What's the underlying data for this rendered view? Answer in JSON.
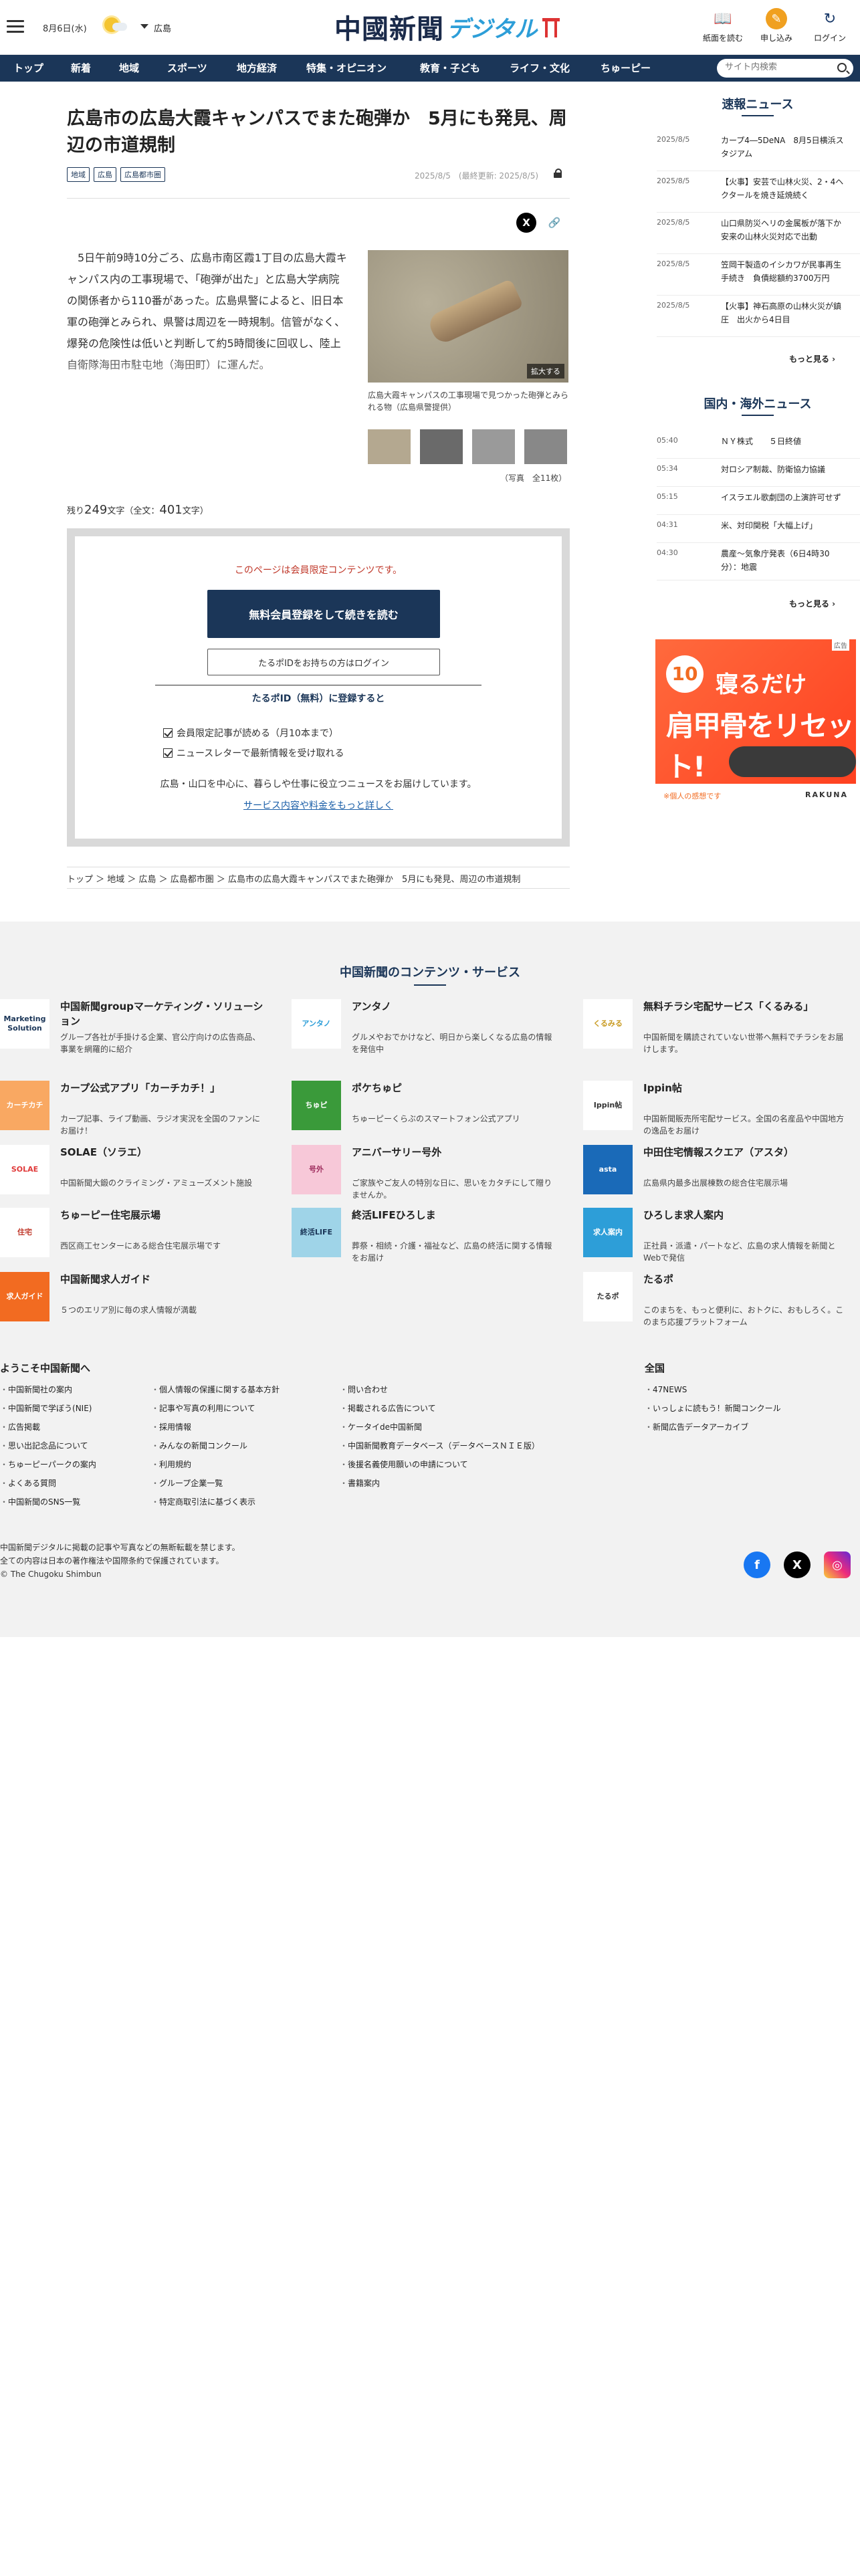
{
  "header": {
    "date": "8月6日(水)",
    "region": "広島",
    "logo_kanji": "中國新聞",
    "logo_digital": "デジタル",
    "buttons": {
      "paper": "紙面を読む",
      "apply": "申し込み",
      "login": "ログイン"
    }
  },
  "nav": {
    "items": [
      "トップ",
      "新着",
      "地域",
      "スポーツ",
      "地方経済",
      "特集・オピニオン",
      "教育・子ども",
      "ライフ・文化",
      "ちゅーピー"
    ],
    "search_placeholder": "サイト内検索"
  },
  "article": {
    "title": "広島市の広島大霞キャンパスでまた砲弾か　5月にも発見、周辺の市道規制",
    "tags": [
      "地域",
      "広島",
      "広島都市圏"
    ],
    "date": "2025/8/5　(最終更新: 2025/8/5)",
    "body": "　5日午前9時10分ごろ、広島市南区霞1丁目の広島大霞キャンパス内の工事現場で、「砲弾が出た」と広島大学病院の関係者から110番があった。広島県警によると、旧日本軍の砲弾とみられ、県警は周辺を一時規制。信管がなく、爆発の危険性は低いと判断して約5時間後に回収し、陸上自衛隊海田市駐屯地（海田町）に運んだ。",
    "photo_zoom": "拡大する",
    "photo_caption": "広島大霞キャンパスの工事現場で見つかった砲弾とみられる物（広島県警提供）",
    "photo_count": "（写真　全11枚）",
    "remain_prefix": "残り",
    "remain_count": "249",
    "remain_mid": "文字（全文：",
    "total_count": "401",
    "remain_suffix": "文字）"
  },
  "paywall": {
    "notice": "このページは会員限定コンテンツです。",
    "register_button": "無料会員登録をして続きを読む",
    "login_button": "たるポIDをお持ちの方はログイン",
    "id_title": "たるポID（無料）に登録すると",
    "benefits": [
      "会員限定記事が読める（月10本まで）",
      "ニュースレターで最新情報を受け取れる"
    ],
    "desc": "広島・山口を中心に、暮らしや仕事に役立つニュースをお届けしています。",
    "more_link": "サービス内容や料金をもっと詳しく"
  },
  "breadcrumb": "トップ ＞ 地域 ＞ 広島 ＞ 広島都市圏 ＞ 広島市の広島大霞キャンパスでまた砲弾か　5月にも発見、周辺の市道規制",
  "sidebar": {
    "breaking_title": "速報ニュース",
    "breaking": [
      {
        "date": "2025/8/5",
        "title": "カープ4―5DeNA　8月5日横浜スタジアム"
      },
      {
        "date": "2025/8/5",
        "title": "【火事】安芸で山林火災、2・4ヘクタールを焼き延焼続く"
      },
      {
        "date": "2025/8/5",
        "title": "山口県防災ヘリの金属板が落下か　安来の山林火災対応で出動"
      },
      {
        "date": "2025/8/5",
        "title": "笠岡干製造のイシカワが民事再生手続き　負債総額約3700万円"
      },
      {
        "date": "2025/8/5",
        "title": "【火事】神石高原の山林火災が鎮圧　出火から4日目"
      }
    ],
    "more1": "もっと見る ›",
    "world_title": "国内・海外ニュース",
    "world": [
      {
        "date": "05:40",
        "title": "ＮＹ株式　　５日終値"
      },
      {
        "date": "05:34",
        "title": "対ロシア制裁、防衛協力協議"
      },
      {
        "date": "05:15",
        "title": "イスラエル歌劇団の上演許可せず"
      },
      {
        "date": "04:31",
        "title": "米、対印関税「大幅上げ」"
      },
      {
        "date": "04:30",
        "title": "農産〜気象庁発表（6日4時30分）：地震"
      }
    ],
    "more2": "もっと見る ›",
    "ad_label": "広告",
    "ad": {
      "badge": "10",
      "line1": "寝るだけ",
      "line2": "肩甲骨をリセット!",
      "foot_left": "※個人の感想です",
      "brand": "RAKUNA"
    }
  },
  "contents": {
    "title": "中国新聞のコンテンツ・サービス",
    "services": [
      {
        "name": "中国新聞groupマーケティング・ソリューション",
        "desc": "グループ各社が手掛ける企業、官公庁向けの広告商品、事業を網羅的に紹介",
        "icon": "Marketing Solution",
        "color": "#ffffff",
        "fg": "#1b3658"
      },
      {
        "name": "アンタノ",
        "desc": "グルメやおでかけなど、明日から楽しくなる広島の情報を発信中",
        "icon": "アンタノ",
        "color": "#ffffff",
        "fg": "#2d9ed8"
      },
      {
        "name": "無料チラシ宅配サービス「くるみる」",
        "desc": "中国新聞を購読されていない世帯へ無料でチラシをお届けします。",
        "icon": "くるみる",
        "color": "#ffffff",
        "fg": "#c89a20"
      },
      {
        "name": "カープ公式アプリ「カーチカチ！」",
        "desc": "カープ記事、ライブ動画、ラジオ実況を全国のファンにお届け！",
        "icon": "カーチカチ",
        "color": "#f9a862",
        "fg": "#ffffff"
      },
      {
        "name": "ポケちゅピ",
        "desc": "ちゅーピーくらぶのスマートフォン公式アプリ",
        "icon": "ちゅピ",
        "color": "#3a9a3a",
        "fg": "#ffffff"
      },
      {
        "name": "Ippin帖",
        "desc": "中国新聞販売所宅配サービス。全国の名産品や中国地方の逸品をお届け",
        "icon": "Ippin帖",
        "color": "#ffffff",
        "fg": "#333333"
      },
      {
        "name": "SOLAE（ソラエ）",
        "desc": "中国新聞大鍛のクライミング・アミューズメント施設",
        "icon": "SOLAE",
        "color": "#ffffff",
        "fg": "#e03a3a"
      },
      {
        "name": "アニバーサリー号外",
        "desc": "ご家族やご友人の特別な日に、思いをカタチにして贈りませんか。",
        "icon": "号外",
        "color": "#f7c8d8",
        "fg": "#a03060"
      },
      {
        "name": "中田住宅情報スクエア（アスタ）",
        "desc": "広島県内最多出展棟数の総合住宅展示場",
        "icon": "asta",
        "color": "#1a6ab8",
        "fg": "#ffffff"
      },
      {
        "name": "ちゅーピー住宅展示場",
        "desc": "西区商工センターにある総合住宅展示場です",
        "icon": "住宅",
        "color": "#ffffff",
        "fg": "#c0392b"
      },
      {
        "name": "終活LIFEひろしま",
        "desc": "葬祭・相続・介護・福祉など、広島の終活に関する情報をお届け",
        "icon": "終活LIFE",
        "color": "#9fd4e8",
        "fg": "#1b3658"
      },
      {
        "name": "ひろしま求人案内",
        "desc": "正社員・派遣・パートなど、広島の求人情報を新聞とWebで発信",
        "icon": "求人案内",
        "color": "#2d9ed8",
        "fg": "#ffffff"
      },
      {
        "name": "中国新聞求人ガイド",
        "desc": "５つのエリア別に毎の求人情報が満載",
        "icon": "求人ガイド",
        "color": "#f26b21",
        "fg": "#ffffff"
      },
      {
        "name": "",
        "desc": "",
        "icon": "",
        "color": "#f2f2f2",
        "fg": "#f2f2f2"
      },
      {
        "name": "たるポ",
        "desc": "このまちを、もっと便利に、おトクに、おもしろく。このまち応援プラットフォーム",
        "icon": "たるポ",
        "color": "#ffffff",
        "fg": "#333333"
      }
    ]
  },
  "footer": {
    "welcome_title": "ようこそ中国新聞へ",
    "col1": [
      "中国新聞社の案内",
      "中国新聞で学ぼう(NIE)",
      "広告掲載",
      "思い出記念品について",
      "ちゅーピーパークの案内",
      "よくある質問",
      "中国新聞のSNS一覧"
    ],
    "col2": [
      "個人情報の保護に関する基本方針",
      "記事や写真の利用について",
      "採用情報",
      "みんなの新聞コンクール",
      "利用規約",
      "グループ企業一覧",
      "特定商取引法に基づく表示"
    ],
    "col3": [
      "問い合わせ",
      "掲載される広告について",
      "ケータイde中国新聞",
      "中国新聞教育データベース（データベースＮＩＥ版）",
      "後援名義使用願いの申請について",
      "書籍案内"
    ],
    "national_title": "全国",
    "national": [
      "47NEWS",
      "いっしょに読もう！新聞コンクール",
      "新聞広告データアーカイブ"
    ],
    "copyright": [
      "中国新聞デジタルに掲載の記事や写真などの無断転載を禁じます。",
      "全ての内容は日本の著作権法や国際条約で保護されています。",
      "© The Chugoku Shimbun"
    ]
  }
}
